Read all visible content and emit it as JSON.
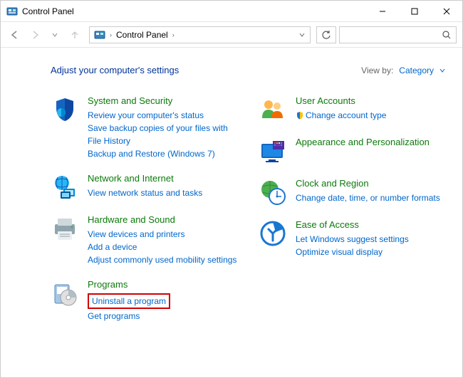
{
  "window": {
    "title": "Control Panel"
  },
  "breadcrumb": {
    "root": "Control Panel"
  },
  "header": {
    "title": "Adjust your computer's settings"
  },
  "viewby": {
    "label": "View by:",
    "value": "Category"
  },
  "left": [
    {
      "title": "System and Security",
      "links": [
        "Review your computer's status",
        "Save backup copies of your files with File History",
        "Backup and Restore (Windows 7)"
      ]
    },
    {
      "title": "Network and Internet",
      "links": [
        "View network status and tasks"
      ]
    },
    {
      "title": "Hardware and Sound",
      "links": [
        "View devices and printers",
        "Add a device",
        "Adjust commonly used mobility settings"
      ]
    },
    {
      "title": "Programs",
      "links": [
        "Uninstall a program",
        "Get programs"
      ]
    }
  ],
  "right": [
    {
      "title": "User Accounts",
      "links": [
        "Change account type"
      ],
      "linkIcons": [
        "shield"
      ]
    },
    {
      "title": "Appearance and Personalization",
      "links": []
    },
    {
      "title": "Clock and Region",
      "links": [
        "Change date, time, or number formats"
      ]
    },
    {
      "title": "Ease of Access",
      "links": [
        "Let Windows suggest settings",
        "Optimize visual display"
      ]
    }
  ]
}
